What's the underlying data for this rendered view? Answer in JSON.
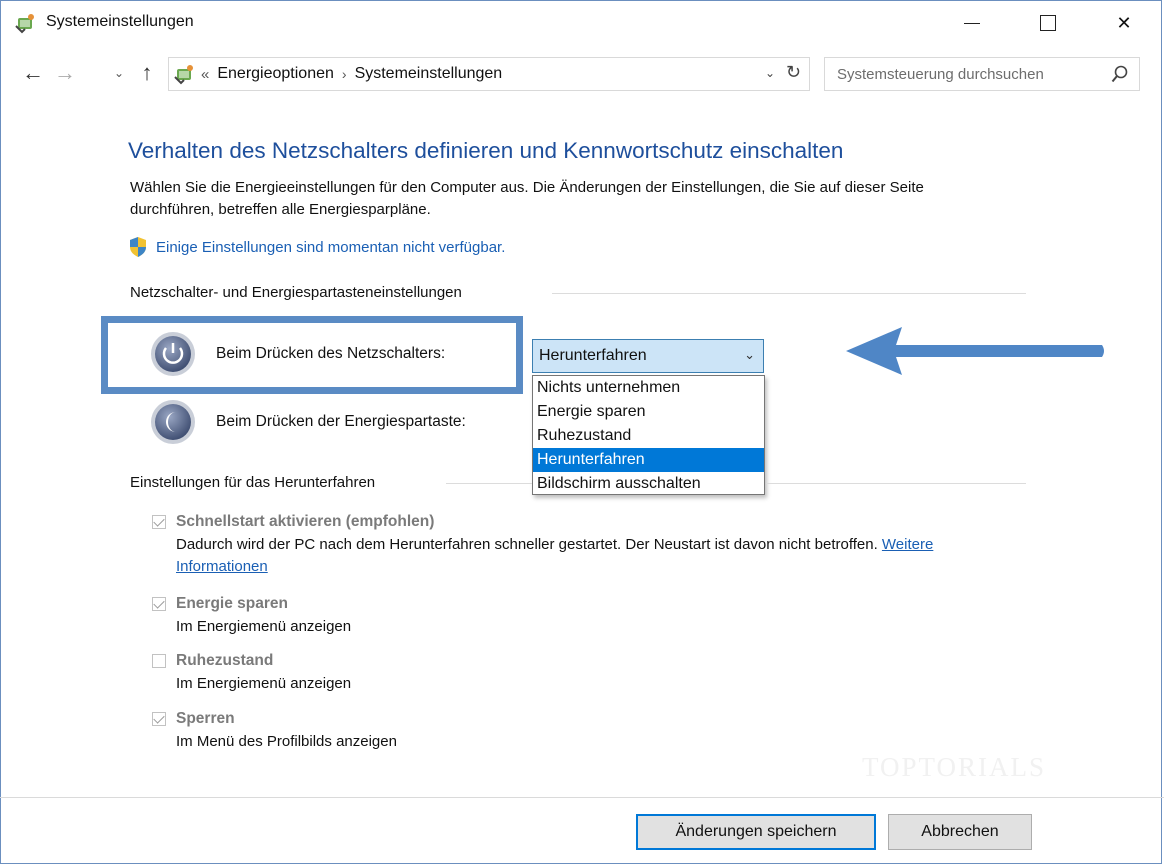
{
  "window": {
    "title": "Systemeinstellungen",
    "icon": "power-options-icon"
  },
  "navigation": {
    "breadcrumb_lead": "«",
    "breadcrumbs": [
      "Energieoptionen",
      "Systemeinstellungen"
    ],
    "search_placeholder": "Systemsteuerung durchsuchen"
  },
  "main": {
    "heading": "Verhalten des Netzschalters definieren und Kennwortschutz einschalten",
    "description": "Wählen Sie die Energieeinstellungen für den Computer aus. Die Änderungen der Einstellungen, die Sie auf dieser Seite durchführen, betreffen alle Energiesparpläne.",
    "admin_link": "Einige Einstellungen sind momentan nicht verfügbar.",
    "power_group": {
      "title": "Netzschalter- und Energiespartasteneinstellungen",
      "power_button_label": "Beim Drücken des Netzschalters:",
      "sleep_button_label": "Beim Drücken der Energiespartaste:",
      "selected_value": "Herunterfahren",
      "options": [
        "Nichts unternehmen",
        "Energie sparen",
        "Ruhezustand",
        "Herunterfahren",
        "Bildschirm ausschalten"
      ],
      "selected_index": 3
    },
    "shutdown_group": {
      "title": "Einstellungen für das Herunterfahren",
      "items": [
        {
          "label": "Schnellstart aktivieren (empfohlen)",
          "checked": true,
          "desc": "Dadurch wird der PC nach dem Herunterfahren schneller gestartet. Der Neustart ist davon nicht betroffen.",
          "link": "Weitere Informationen"
        },
        {
          "label": "Energie sparen",
          "checked": true,
          "desc": "Im Energiemenü anzeigen"
        },
        {
          "label": "Ruhezustand",
          "checked": false,
          "desc": "Im Energiemenü anzeigen"
        },
        {
          "label": "Sperren",
          "checked": true,
          "desc": "Im Menü des Profilbilds anzeigen"
        }
      ]
    },
    "watermark": "TOPTORIALS"
  },
  "footer": {
    "save_label": "Änderungen speichern",
    "cancel_label": "Abbrechen"
  },
  "colors": {
    "heading": "#1e4f9c",
    "link": "#1a5fb4",
    "highlight": "#5a8bc4",
    "selection": "#0078d7"
  }
}
